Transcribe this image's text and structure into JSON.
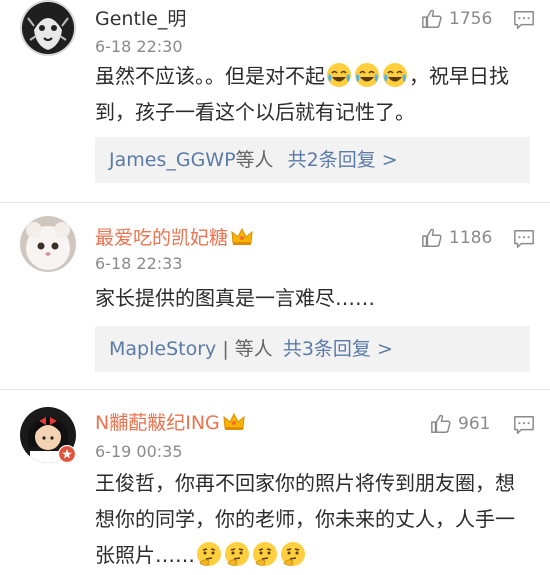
{
  "comments": [
    {
      "username": "Gentle_明",
      "time": "6-18 22:30",
      "likes": "1756",
      "vip": false,
      "content_parts": [
        "虽然不应该。。但是对不起",
        "，祝早日找到，孩子一看这个以后就有记性了。"
      ],
      "emoji": "laugh-cry-emoji",
      "emoji_count": 3,
      "replies": {
        "user": "James_GGWP",
        "others": "等人",
        "count_text": "共2条回复 >"
      }
    },
    {
      "username": "最爱吃的凯妃糖",
      "time": "6-18 22:33",
      "likes": "1186",
      "vip": true,
      "content_parts": [
        "家长提供的图真是一言难尽……"
      ],
      "replies": {
        "user": "MapleStory",
        "separator": "|",
        "others": "等人",
        "count_text": "共3条回复 >"
      }
    },
    {
      "username": "N黼蓜黻纪ING",
      "time": "6-19 00:35",
      "likes": "961",
      "vip": true,
      "content_parts": [
        "王俊哲，你再不回家你的照片将传到朋友圈，想想你的同学，你的老师，你未来的丈人，人手一张照片……"
      ],
      "emoji": "thinking-emoji",
      "emoji_count": 4
    }
  ],
  "colors": {
    "vip_name": "#eb7350",
    "link_blue": "#5b7ba7",
    "meta_grey": "#8a8a8a",
    "reply_bg": "#f2f2f2"
  },
  "icons": [
    "thumbs-up-icon",
    "comment-icon",
    "crown-icon"
  ]
}
